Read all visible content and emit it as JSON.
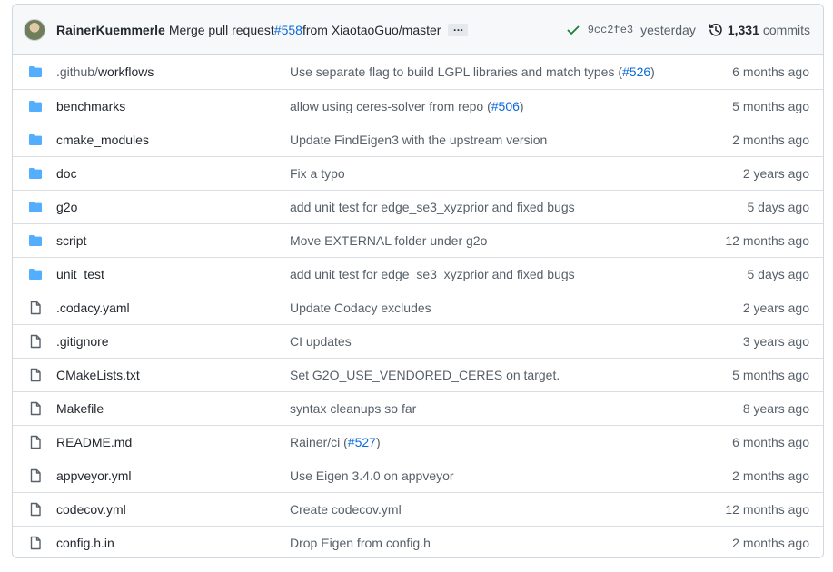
{
  "commit": {
    "author": "RainerKuemmerle",
    "message_prefix": "Merge pull request ",
    "pr_link": "#558",
    "message_suffix": " from XiaotaoGuo/master",
    "ellipsis": "…",
    "sha": "9cc2fe3",
    "when": "yesterday",
    "commits_count": "1,331",
    "commits_label": "commits",
    "status_color": "#1a7f37",
    "icons": {
      "status": "check-icon",
      "history": "history-icon"
    }
  },
  "colors": {
    "folder": "#54aeff",
    "file": "#57606a",
    "link": "#0969da"
  },
  "files": [
    {
      "type": "folder",
      "name_prefix": ".github/",
      "name": "workflows",
      "msg_before": "Use separate flag to build LGPL libraries and match types (",
      "msg_link": "#526",
      "msg_after": ")",
      "age": "6 months ago"
    },
    {
      "type": "folder",
      "name_prefix": "",
      "name": "benchmarks",
      "msg_before": "allow using ceres-solver from repo (",
      "msg_link": "#506",
      "msg_after": ")",
      "age": "5 months ago"
    },
    {
      "type": "folder",
      "name_prefix": "",
      "name": "cmake_modules",
      "msg_before": "Update FindEigen3 with the upstream version",
      "msg_link": "",
      "msg_after": "",
      "age": "2 months ago"
    },
    {
      "type": "folder",
      "name_prefix": "",
      "name": "doc",
      "msg_before": "Fix a typo",
      "msg_link": "",
      "msg_after": "",
      "age": "2 years ago"
    },
    {
      "type": "folder",
      "name_prefix": "",
      "name": "g2o",
      "msg_before": "add unit test for edge_se3_xyzprior and fixed bugs",
      "msg_link": "",
      "msg_after": "",
      "age": "5 days ago"
    },
    {
      "type": "folder",
      "name_prefix": "",
      "name": "script",
      "msg_before": "Move EXTERNAL folder under g2o",
      "msg_link": "",
      "msg_after": "",
      "age": "12 months ago"
    },
    {
      "type": "folder",
      "name_prefix": "",
      "name": "unit_test",
      "msg_before": "add unit test for edge_se3_xyzprior and fixed bugs",
      "msg_link": "",
      "msg_after": "",
      "age": "5 days ago"
    },
    {
      "type": "file",
      "name_prefix": "",
      "name": ".codacy.yaml",
      "msg_before": "Update Codacy excludes",
      "msg_link": "",
      "msg_after": "",
      "age": "2 years ago"
    },
    {
      "type": "file",
      "name_prefix": "",
      "name": ".gitignore",
      "msg_before": "CI updates",
      "msg_link": "",
      "msg_after": "",
      "age": "3 years ago"
    },
    {
      "type": "file",
      "name_prefix": "",
      "name": "CMakeLists.txt",
      "msg_before": "Set G2O_USE_VENDORED_CERES on target.",
      "msg_link": "",
      "msg_after": "",
      "age": "5 months ago"
    },
    {
      "type": "file",
      "name_prefix": "",
      "name": "Makefile",
      "msg_before": "syntax cleanups so far",
      "msg_link": "",
      "msg_after": "",
      "age": "8 years ago"
    },
    {
      "type": "file",
      "name_prefix": "",
      "name": "README.md",
      "msg_before": "Rainer/ci (",
      "msg_link": "#527",
      "msg_after": ")",
      "age": "6 months ago"
    },
    {
      "type": "file",
      "name_prefix": "",
      "name": "appveyor.yml",
      "msg_before": "Use Eigen 3.4.0 on appveyor",
      "msg_link": "",
      "msg_after": "",
      "age": "2 months ago"
    },
    {
      "type": "file",
      "name_prefix": "",
      "name": "codecov.yml",
      "msg_before": "Create codecov.yml",
      "msg_link": "",
      "msg_after": "",
      "age": "12 months ago"
    },
    {
      "type": "file",
      "name_prefix": "",
      "name": "config.h.in",
      "msg_before": "Drop Eigen from config.h",
      "msg_link": "",
      "msg_after": "",
      "age": "2 months ago"
    }
  ]
}
